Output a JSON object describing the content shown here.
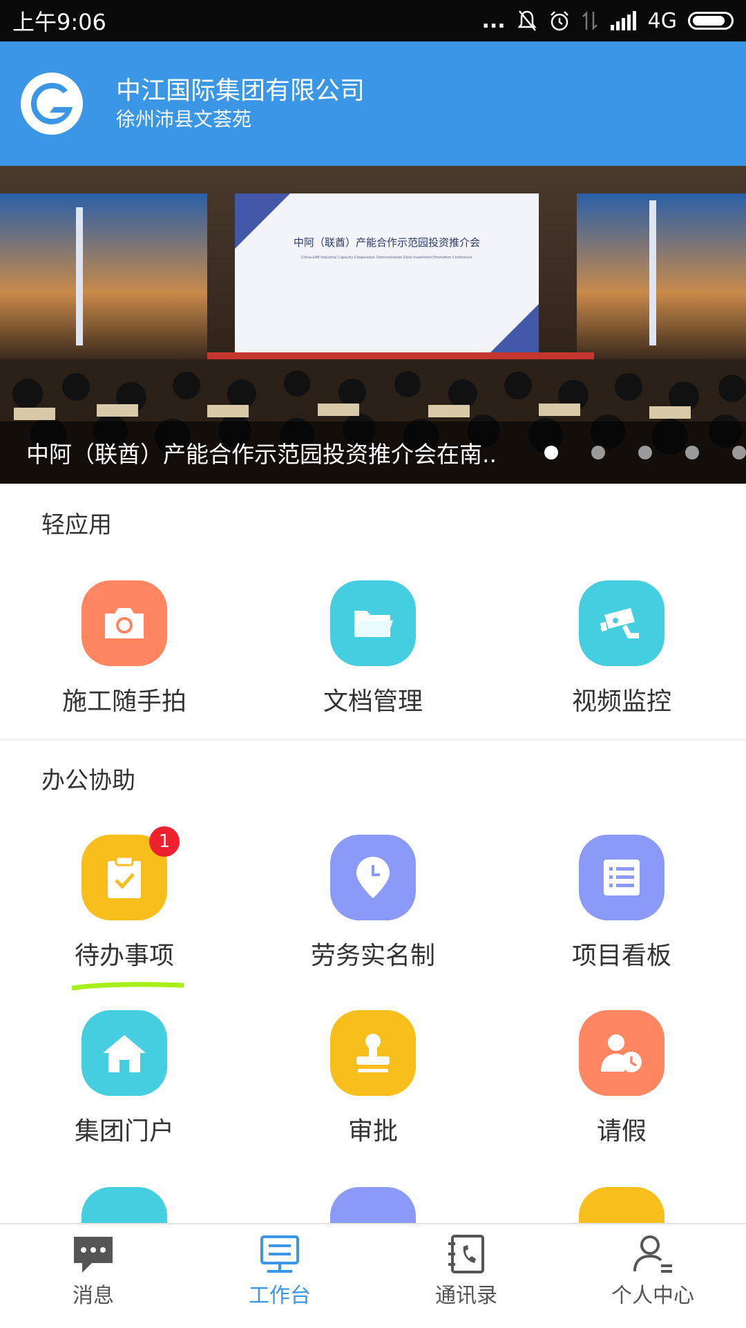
{
  "status_bar": {
    "time": "上午9:06",
    "network": "4G",
    "dots": "..."
  },
  "header": {
    "company": "中江国际集团有限公司",
    "location": "徐州沛县文荟苑"
  },
  "banner": {
    "caption": "中阿（联酋）产能合作示范园投资推介会在南..",
    "screen_title": "中阿（联酋）产能合作示范园投资推介会",
    "screen_subtitle": "China-UAE Industrial Capacity Cooperation Demonstration Zone Investment Promotion Conference",
    "slide_count": 5,
    "active_slide": 1
  },
  "sections": {
    "light_apps": {
      "title": "轻应用",
      "items": [
        {
          "label": "施工随手拍",
          "icon": "camera-icon",
          "color": "#ff8661"
        },
        {
          "label": "文档管理",
          "icon": "folder-icon",
          "color": "#45cde0"
        },
        {
          "label": "视频监控",
          "icon": "cctv-icon",
          "color": "#45cde0"
        }
      ]
    },
    "office": {
      "title": "办公协助",
      "items": [
        {
          "label": "待办事项",
          "icon": "clipboard-check-icon",
          "color": "#f7be1c",
          "badge": "1"
        },
        {
          "label": "劳务实名制",
          "icon": "location-clock-icon",
          "color": "#8c9af7"
        },
        {
          "label": "项目看板",
          "icon": "list-icon",
          "color": "#8c9af7"
        },
        {
          "label": "集团门户",
          "icon": "home-icon",
          "color": "#45cde0"
        },
        {
          "label": "审批",
          "icon": "stamp-icon",
          "color": "#f7be1c"
        },
        {
          "label": "请假",
          "icon": "person-clock-icon",
          "color": "#ff8661"
        }
      ]
    }
  },
  "tabbar": {
    "items": [
      {
        "label": "消息",
        "icon": "chat-icon",
        "active": false
      },
      {
        "label": "工作台",
        "icon": "workbench-icon",
        "active": true
      },
      {
        "label": "通讯录",
        "icon": "contacts-icon",
        "active": false
      },
      {
        "label": "个人中心",
        "icon": "person-icon",
        "active": false
      }
    ],
    "active_color": "#3b97e6"
  }
}
